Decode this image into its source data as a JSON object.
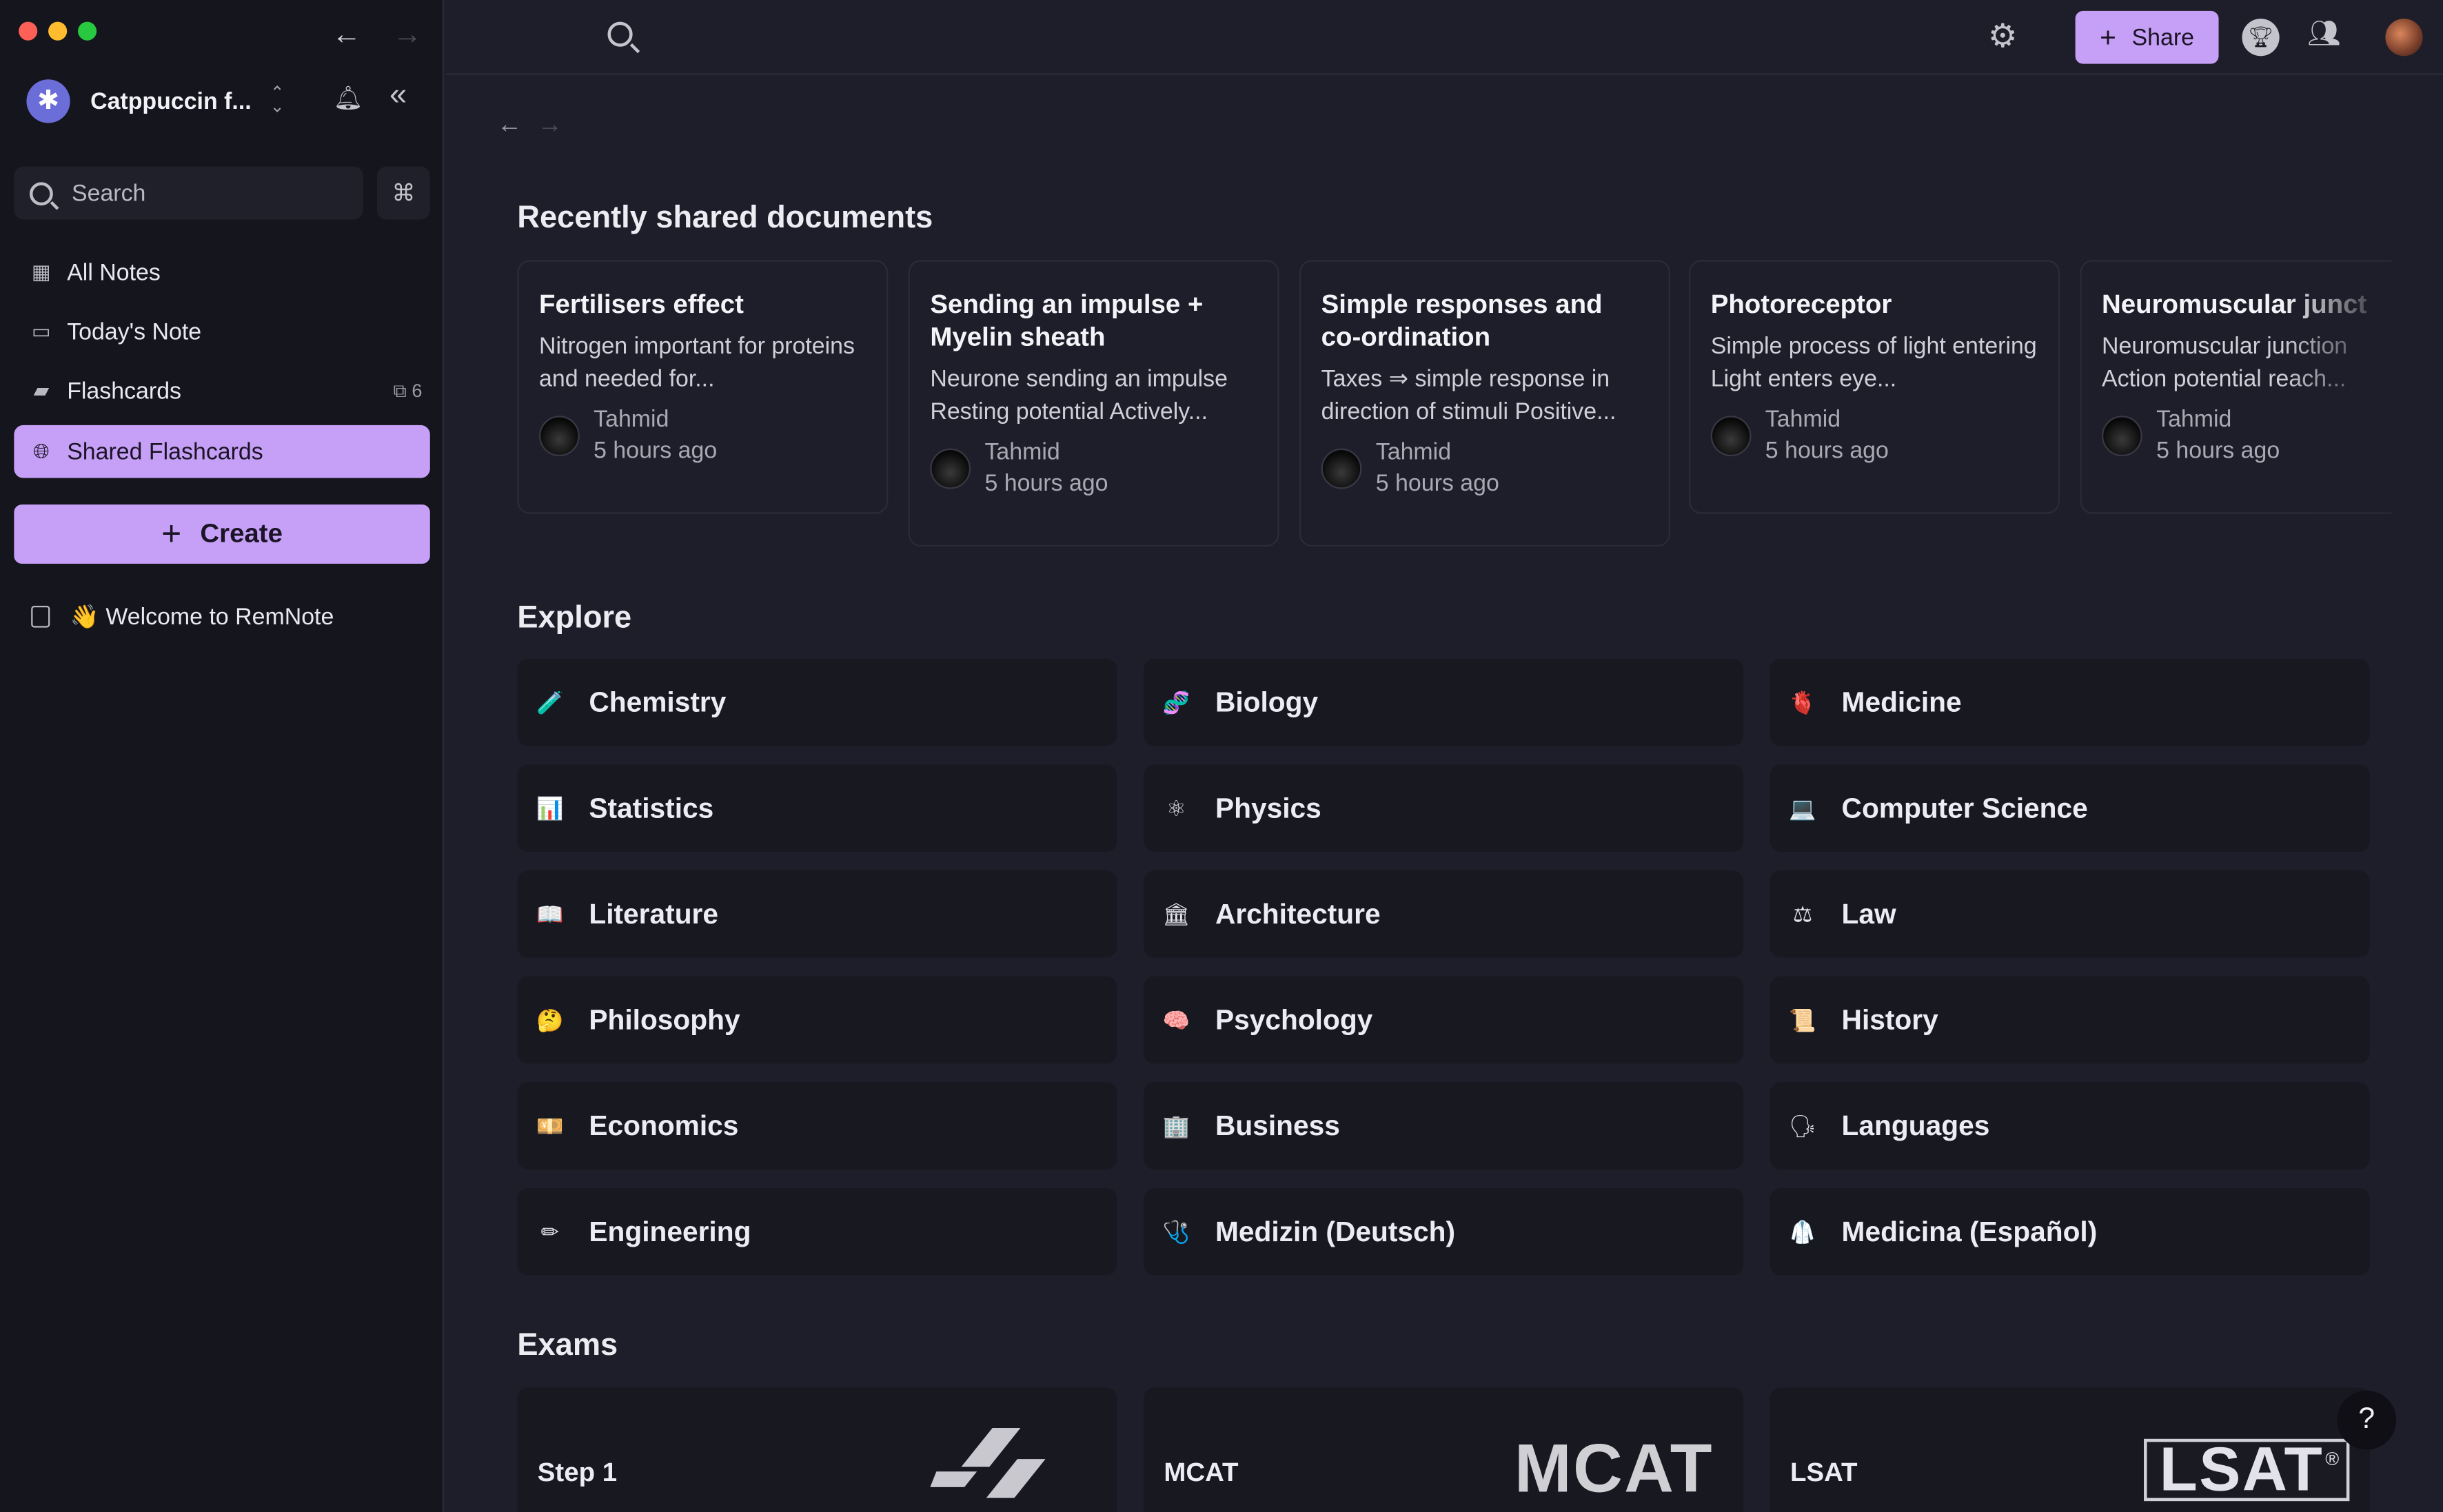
{
  "sidebar": {
    "workspace": {
      "name": "Catppuccin f...",
      "avatar_icon": "sun-icon"
    },
    "search": {
      "label": "Search",
      "shortcut": "⌘"
    },
    "items": [
      {
        "label": "All Notes",
        "icon": "grid-icon"
      },
      {
        "label": "Today's Note",
        "icon": "calendar-icon"
      },
      {
        "label": "Flashcards",
        "icon": "cards-icon",
        "badge": "6"
      },
      {
        "label": "Shared Flashcards",
        "icon": "globe-icon",
        "active": true
      }
    ],
    "create_label": "Create",
    "documents": [
      {
        "label": "👋 Welcome to RemNote",
        "icon": "document-icon"
      }
    ]
  },
  "topbar": {
    "share_label": "Share"
  },
  "main": {
    "recent_heading": "Recently shared documents",
    "cards": [
      {
        "title": "Fertilisers effect",
        "desc": "Nitrogen important for proteins and needed for...",
        "author": "Tahmid",
        "time": "5 hours ago"
      },
      {
        "title": "Sending an impulse + Myelin sheath",
        "desc": "Neurone sending an impulse Resting potential Actively...",
        "author": "Tahmid",
        "time": "5 hours ago"
      },
      {
        "title": "Simple responses and co-ordination",
        "desc": "Taxes ⇒ simple response in direction of stimuli Positive...",
        "author": "Tahmid",
        "time": "5 hours ago"
      },
      {
        "title": "Photoreceptor",
        "desc": "Simple process of light entering Light enters eye...",
        "author": "Tahmid",
        "time": "5 hours ago"
      },
      {
        "title": "Neuromuscular junct",
        "desc": "Neuromuscular junction Action potential reach...",
        "author": "Tahmid",
        "time": "5 hours ago"
      }
    ],
    "explore_heading": "Explore",
    "explore": [
      {
        "label": "Chemistry",
        "emoji": "🧪"
      },
      {
        "label": "Biology",
        "emoji": "🧬"
      },
      {
        "label": "Medicine",
        "emoji": "🫀"
      },
      {
        "label": "Statistics",
        "emoji": "📊"
      },
      {
        "label": "Physics",
        "emoji": "⚛"
      },
      {
        "label": "Computer Science",
        "emoji": "💻"
      },
      {
        "label": "Literature",
        "emoji": "📖"
      },
      {
        "label": "Architecture",
        "emoji": "🏛"
      },
      {
        "label": "Law",
        "emoji": "⚖"
      },
      {
        "label": "Philosophy",
        "emoji": "🤔"
      },
      {
        "label": "Psychology",
        "emoji": "🧠"
      },
      {
        "label": "History",
        "emoji": "📜"
      },
      {
        "label": "Economics",
        "emoji": "💴"
      },
      {
        "label": "Business",
        "emoji": "🏢"
      },
      {
        "label": "Languages",
        "emoji": "🗣"
      },
      {
        "label": "Engineering",
        "emoji": "✏"
      },
      {
        "label": "Medizin (Deutsch)",
        "emoji": "🩺"
      },
      {
        "label": "Medicina (Español)",
        "emoji": "🥼"
      }
    ],
    "exams_heading": "Exams",
    "exams": [
      {
        "label": "Step 1",
        "logo": ""
      },
      {
        "label": "MCAT",
        "logo": "MCAT"
      },
      {
        "label": "LSAT",
        "logo": "LSAT"
      }
    ],
    "help_label": "?"
  }
}
